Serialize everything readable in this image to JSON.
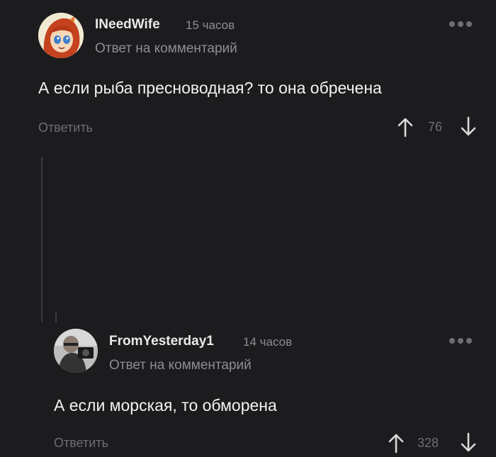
{
  "comments": [
    {
      "username": "INeedWife",
      "time": "15 часов",
      "reply_note": "Ответ на комментарий",
      "text": "А если рыба пресноводная? то она обречена",
      "reply_label": "Ответить",
      "votes": "76",
      "avatar": "anime-girl-avatar"
    },
    {
      "username": "FromYesterday1",
      "time": "14 часов",
      "reply_note": "Ответ на комментарий",
      "text": "А если морская, то обморена",
      "reply_label": "Ответить",
      "votes": "328",
      "avatar": "photo-avatar"
    }
  ],
  "icons": {
    "upvote": "arrow-up-icon",
    "downvote": "arrow-down-icon",
    "more": "more-dots-icon"
  },
  "colors": {
    "background": "#1c1c1e",
    "text": "#f2f2f3",
    "muted": "#8e8e93"
  }
}
